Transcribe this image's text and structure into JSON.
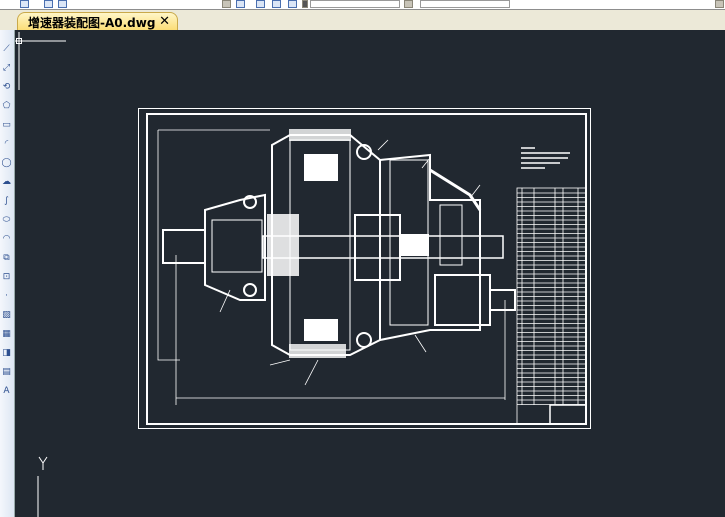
{
  "document_tab": {
    "title": "增速器装配图-A0.dwg",
    "close_glyph": "✕"
  },
  "ucs": {
    "y_axis_label": "Y"
  },
  "colors": {
    "canvas": "#212830",
    "lines": "#ffffff",
    "tab": "#fbdc72"
  },
  "left_toolbar": {
    "icons": [
      "line-icon",
      "construction-line-icon",
      "polyline-icon",
      "polygon-icon",
      "rectangle-icon",
      "arc-icon",
      "circle-icon",
      "revision-cloud-icon",
      "spline-icon",
      "ellipse-icon",
      "ellipse-arc-icon",
      "insert-block-icon",
      "make-block-icon",
      "point-icon",
      "hatch-icon",
      "gradient-icon",
      "region-icon",
      "table-icon",
      "mtext-icon"
    ]
  }
}
